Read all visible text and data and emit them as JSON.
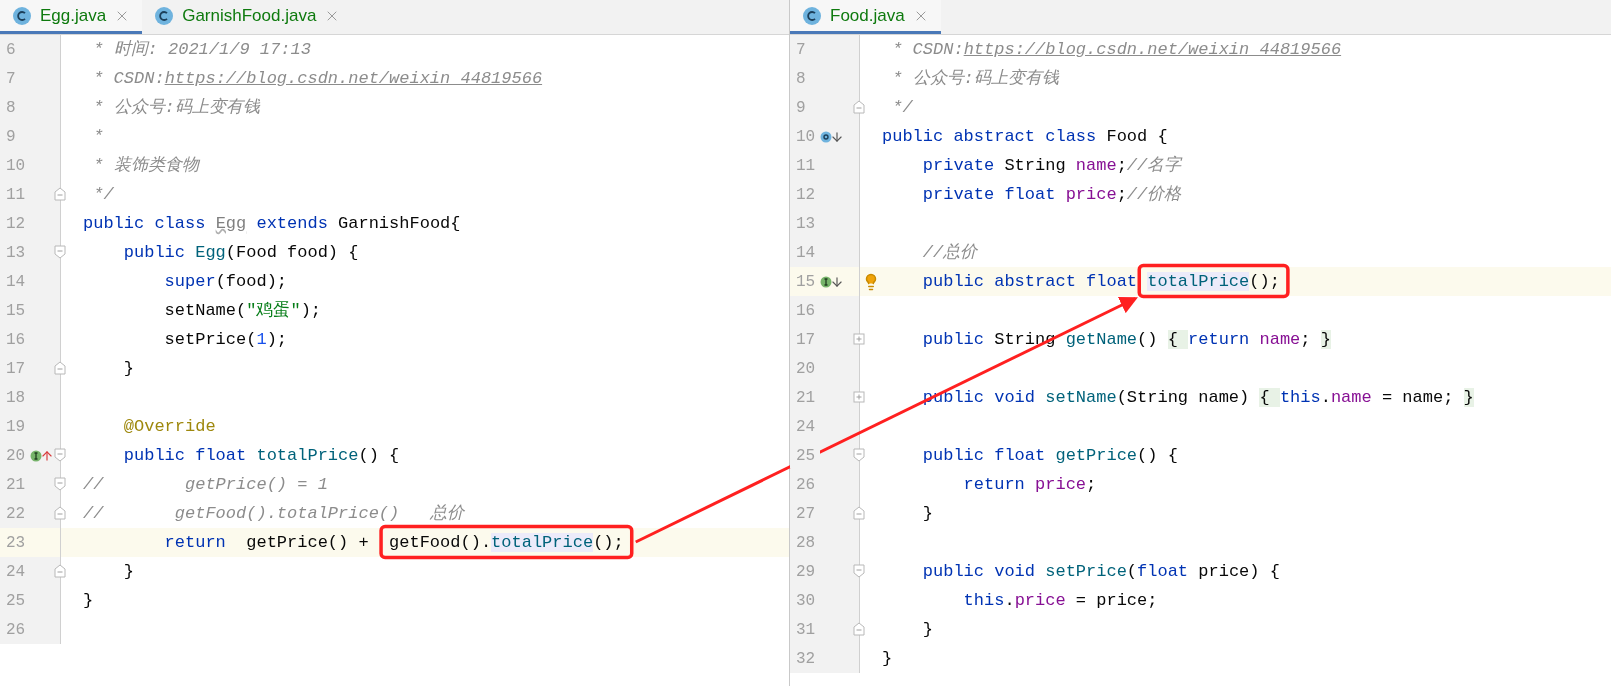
{
  "panes": [
    {
      "tabs": [
        {
          "label": "Egg.java",
          "selected": true
        },
        {
          "label": "GarnishFood.java",
          "selected": false
        }
      ],
      "lines": [
        {
          "num": "6",
          "current": false,
          "segments": [
            {
              "kind": "comment",
              "text": " * 时间: 2021/1/9 17:13"
            }
          ]
        },
        {
          "num": "7",
          "current": false,
          "segments": [
            {
              "kind": "comment",
              "text": " * CSDN:"
            },
            {
              "kind": "link",
              "text": "https://blog.csdn.net/weixin_44819566"
            }
          ]
        },
        {
          "num": "8",
          "current": false,
          "segments": [
            {
              "kind": "comment",
              "text": " * 公众号:码上变有钱"
            }
          ]
        },
        {
          "num": "9",
          "current": false,
          "segments": [
            {
              "kind": "comment",
              "text": " *"
            }
          ]
        },
        {
          "num": "10",
          "current": false,
          "segments": [
            {
              "kind": "comment",
              "text": " * 装饰类食物"
            }
          ]
        },
        {
          "num": "11",
          "current": false,
          "fold_end": true,
          "segments": [
            {
              "kind": "comment",
              "text": " */"
            }
          ]
        },
        {
          "num": "12",
          "current": false,
          "segments": [
            {
              "kind": "keyword",
              "text": "public class "
            },
            {
              "kind": "unused",
              "text": "Egg"
            },
            {
              "kind": "keyword",
              "text": " extends "
            },
            {
              "kind": "plain",
              "text": "GarnishFood{"
            }
          ]
        },
        {
          "num": "13",
          "current": false,
          "fold_start": true,
          "segments": [
            {
              "kind": "keyword",
              "text": "    public "
            },
            {
              "kind": "method",
              "text": "Egg"
            },
            {
              "kind": "plain",
              "text": "(Food food) {"
            }
          ]
        },
        {
          "num": "14",
          "current": false,
          "segments": [
            {
              "kind": "keyword",
              "text": "        super"
            },
            {
              "kind": "plain",
              "text": "(food);"
            }
          ]
        },
        {
          "num": "15",
          "current": false,
          "segments": [
            {
              "kind": "plain",
              "text": "        setName("
            },
            {
              "kind": "string",
              "text": "\"鸡蛋\""
            },
            {
              "kind": "plain",
              "text": ");"
            }
          ]
        },
        {
          "num": "16",
          "current": false,
          "segments": [
            {
              "kind": "plain",
              "text": "        setPrice("
            },
            {
              "kind": "number",
              "text": "1"
            },
            {
              "kind": "plain",
              "text": ");"
            }
          ]
        },
        {
          "num": "17",
          "current": false,
          "fold_end": true,
          "segments": [
            {
              "kind": "plain",
              "text": "    }"
            }
          ]
        },
        {
          "num": "18",
          "current": false
        },
        {
          "num": "19",
          "current": false,
          "segments": [
            {
              "kind": "annotation",
              "text": "    @Override"
            }
          ]
        },
        {
          "num": "20",
          "current": false,
          "fold_start": true,
          "gutter_marker": {
            "kind": "implements-up"
          },
          "segments": [
            {
              "kind": "keyword",
              "text": "    public float "
            },
            {
              "kind": "method",
              "text": "totalPrice"
            },
            {
              "kind": "plain",
              "text": "() {"
            }
          ]
        },
        {
          "num": "21",
          "current": false,
          "fold_start": true,
          "segments": [
            {
              "kind": "comment",
              "text": "//        getPrice() = 1"
            }
          ]
        },
        {
          "num": "22",
          "current": false,
          "fold_end": true,
          "segments": [
            {
              "kind": "comment",
              "text": "//       getFood().totalPrice()   总价"
            }
          ]
        },
        {
          "num": "23",
          "current": true,
          "segments": [
            {
              "kind": "keyword",
              "text": "        return"
            },
            {
              "kind": "plain",
              "text": "  getPrice() +  "
            },
            {
              "kind": "boxed",
              "segments": [
                {
                  "kind": "plain",
                  "text": "getFood()."
                },
                {
                  "kind": "usage",
                  "text": "totalPrice"
                },
                {
                  "kind": "plain",
                  "text": "();"
                }
              ]
            }
          ]
        },
        {
          "num": "24",
          "current": false,
          "fold_end": true,
          "segments": [
            {
              "kind": "plain",
              "text": "    }"
            }
          ]
        },
        {
          "num": "25",
          "current": false,
          "segments": [
            {
              "kind": "plain",
              "text": "}"
            }
          ]
        },
        {
          "num": "26",
          "current": false
        }
      ]
    },
    {
      "tabs": [
        {
          "label": "Food.java",
          "selected": true
        }
      ],
      "lines": [
        {
          "num": "7",
          "current": false,
          "segments": [
            {
              "kind": "comment",
              "text": " * CSDN:"
            },
            {
              "kind": "link",
              "text": "https://blog.csdn.net/weixin_44819566"
            }
          ]
        },
        {
          "num": "8",
          "current": false,
          "segments": [
            {
              "kind": "comment",
              "text": " * 公众号:码上变有钱"
            }
          ]
        },
        {
          "num": "9",
          "current": false,
          "fold_end": true,
          "segments": [
            {
              "kind": "comment",
              "text": " */"
            }
          ]
        },
        {
          "num": "10",
          "current": false,
          "gutter_marker": {
            "kind": "overridden-down"
          },
          "segments": [
            {
              "kind": "keyword",
              "text": "public abstract class "
            },
            {
              "kind": "plain",
              "text": "Food {"
            }
          ]
        },
        {
          "num": "11",
          "current": false,
          "segments": [
            {
              "kind": "keyword",
              "text": "    private "
            },
            {
              "kind": "plain",
              "text": "String "
            },
            {
              "kind": "field",
              "text": "name"
            },
            {
              "kind": "plain",
              "text": ";"
            },
            {
              "kind": "comment",
              "text": "//名字"
            }
          ]
        },
        {
          "num": "12",
          "current": false,
          "segments": [
            {
              "kind": "keyword",
              "text": "    private float "
            },
            {
              "kind": "field",
              "text": "price"
            },
            {
              "kind": "plain",
              "text": ";"
            },
            {
              "kind": "comment",
              "text": "//价格"
            }
          ]
        },
        {
          "num": "13",
          "current": false
        },
        {
          "num": "14",
          "current": false,
          "segments": [
            {
              "kind": "comment",
              "text": "    //总价"
            }
          ]
        },
        {
          "num": "15",
          "current": true,
          "bulb": true,
          "gutter_marker": {
            "kind": "implemented-down"
          },
          "segments": [
            {
              "kind": "keyword",
              "text": "    public abstract float "
            },
            {
              "kind": "boxed",
              "segments": [
                {
                  "kind": "usage",
                  "text": "totalPrice"
                },
                {
                  "kind": "plain",
                  "text": "();"
                }
              ]
            }
          ]
        },
        {
          "num": "16",
          "current": false
        },
        {
          "num": "17",
          "current": false,
          "collapsed": true,
          "segments": [
            {
              "kind": "keyword",
              "text": "    public "
            },
            {
              "kind": "plain",
              "text": "String "
            },
            {
              "kind": "method",
              "text": "getName"
            },
            {
              "kind": "plain",
              "text": "() "
            },
            {
              "kind": "folded",
              "text": "{ "
            },
            {
              "kind": "keyword",
              "text": "return "
            },
            {
              "kind": "field",
              "text": "name"
            },
            {
              "kind": "plain",
              "text": "; "
            },
            {
              "kind": "folded",
              "text": "}"
            }
          ]
        },
        {
          "num": "20",
          "current": false
        },
        {
          "num": "21",
          "current": false,
          "collapsed": true,
          "segments": [
            {
              "kind": "keyword",
              "text": "    public void "
            },
            {
              "kind": "method",
              "text": "setName"
            },
            {
              "kind": "plain",
              "text": "(String name) "
            },
            {
              "kind": "folded",
              "text": "{ "
            },
            {
              "kind": "keyword",
              "text": "this"
            },
            {
              "kind": "plain",
              "text": "."
            },
            {
              "kind": "field",
              "text": "name"
            },
            {
              "kind": "plain",
              "text": " = name; "
            },
            {
              "kind": "folded",
              "text": "}"
            }
          ]
        },
        {
          "num": "24",
          "current": false
        },
        {
          "num": "25",
          "current": false,
          "fold_start": true,
          "segments": [
            {
              "kind": "keyword",
              "text": "    public float "
            },
            {
              "kind": "method",
              "text": "getPrice"
            },
            {
              "kind": "plain",
              "text": "() {"
            }
          ]
        },
        {
          "num": "26",
          "current": false,
          "segments": [
            {
              "kind": "keyword",
              "text": "        return "
            },
            {
              "kind": "field",
              "text": "price"
            },
            {
              "kind": "plain",
              "text": ";"
            }
          ]
        },
        {
          "num": "27",
          "current": false,
          "fold_end": true,
          "segments": [
            {
              "kind": "plain",
              "text": "    }"
            }
          ]
        },
        {
          "num": "28",
          "current": false
        },
        {
          "num": "29",
          "current": false,
          "fold_start": true,
          "segments": [
            {
              "kind": "keyword",
              "text": "    public void "
            },
            {
              "kind": "method",
              "text": "setPrice"
            },
            {
              "kind": "plain",
              "text": "("
            },
            {
              "kind": "keyword",
              "text": "float "
            },
            {
              "kind": "plain",
              "text": "price) {"
            }
          ]
        },
        {
          "num": "30",
          "current": false,
          "segments": [
            {
              "kind": "keyword",
              "text": "        this"
            },
            {
              "kind": "plain",
              "text": "."
            },
            {
              "kind": "field",
              "text": "price"
            },
            {
              "kind": "plain",
              "text": " = price;"
            }
          ]
        },
        {
          "num": "31",
          "current": false,
          "fold_end": true,
          "segments": [
            {
              "kind": "plain",
              "text": "    }"
            }
          ]
        },
        {
          "num": "32",
          "current": false,
          "segments": [
            {
              "kind": "plain",
              "text": "}"
            }
          ]
        }
      ]
    }
  ]
}
